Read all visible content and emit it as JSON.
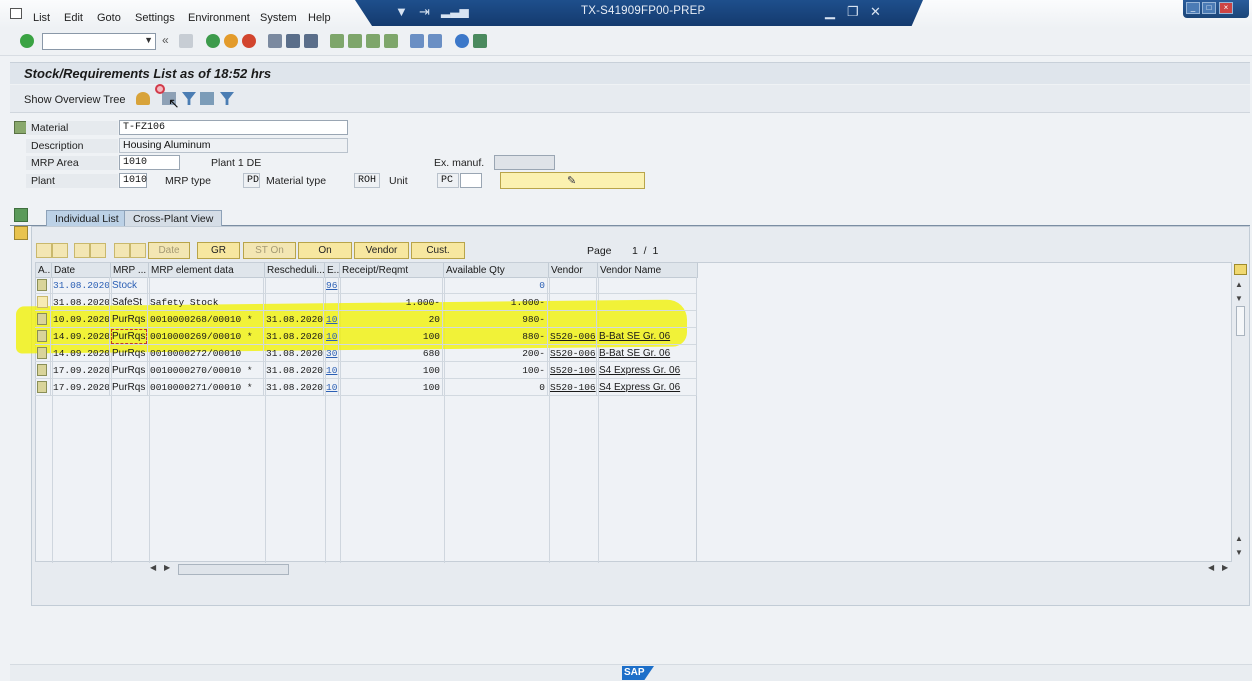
{
  "menu": {
    "items": [
      "List",
      "Edit",
      "Goto",
      "Settings",
      "Environment",
      "System",
      "Help"
    ],
    "underline": [
      "L",
      "E",
      "G",
      "S",
      "n",
      "S",
      "H"
    ]
  },
  "window": {
    "title": "TX-S41909FP00-PREP"
  },
  "page": {
    "title": "Stock/Requirements List as of 18:52 hrs"
  },
  "app_toolbar": {
    "show_tree": "Show Overview Tree"
  },
  "header": {
    "material_label": "Material",
    "material_value": "T-FZ106",
    "description_label": "Description",
    "description_value": "Housing Aluminum",
    "mrp_area_label": "MRP Area",
    "mrp_area_value": "1010",
    "mrp_area_text": "Plant 1 DE",
    "ex_manuf_label": "Ex. manuf.",
    "plant_label": "Plant",
    "plant_value": "1010",
    "mrp_type_label": "MRP type",
    "mrp_type_value": "PD",
    "material_type_label": "Material type",
    "material_type_value": "ROH",
    "unit_label": "Unit",
    "unit_value": "PC"
  },
  "tabs": [
    "Individual List",
    "Cross-Plant View"
  ],
  "grid_toolbar": {
    "date": "Date",
    "gr": "GR",
    "st_on": "ST On",
    "on": "On",
    "vendor": "Vendor",
    "cust": "Cust.",
    "page_label": "Page",
    "page_current": "1",
    "page_total": "1"
  },
  "columns": [
    "A..",
    "Date",
    "MRP ...",
    "MRP element data",
    "Rescheduli...",
    "E..",
    "Receipt/Reqmt",
    "Available Qty",
    "Vendor",
    "Vendor Name"
  ],
  "rows": [
    {
      "date": "31.08.2020",
      "mrp": "Stock",
      "element": "",
      "resched": "",
      "exc": "96",
      "receipt": "",
      "avail": "0",
      "vendor": "",
      "vendor_name": ""
    },
    {
      "date": "31.08.2020",
      "mrp": "SafeSt",
      "element": "Safety Stock",
      "resched": "",
      "exc": "",
      "receipt": "1.000-",
      "avail": "1.000-",
      "vendor": "",
      "vendor_name": ""
    },
    {
      "date": "10.09.2020",
      "mrp": "PurRqs",
      "element": "0010000268/00010 *",
      "resched": "31.08.2020",
      "exc": "10",
      "receipt": "20",
      "avail": "980-",
      "vendor": "",
      "vendor_name": ""
    },
    {
      "date": "14.09.2020",
      "mrp": "PurRqs",
      "element": "0010000269/00010 *",
      "resched": "31.08.2020",
      "exc": "10",
      "receipt": "100",
      "avail": "880-",
      "vendor": "S520-006",
      "vendor_name": "B-Bat SE Gr. 06"
    },
    {
      "date": "14.09.2020",
      "mrp": "PurRqs",
      "element": "0010000272/00010",
      "resched": "31.08.2020",
      "exc": "30",
      "receipt": "680",
      "avail": "200-",
      "vendor": "S520-006",
      "vendor_name": "B-Bat SE Gr. 06"
    },
    {
      "date": "17.09.2020",
      "mrp": "PurRqs",
      "element": "0010000270/00010 *",
      "resched": "31.08.2020",
      "exc": "10",
      "receipt": "100",
      "avail": "100-",
      "vendor": "S520-106",
      "vendor_name": "S4 Express Gr. 06"
    },
    {
      "date": "17.09.2020",
      "mrp": "PurRqs",
      "element": "0010000271/00010 *",
      "resched": "31.08.2020",
      "exc": "10",
      "receipt": "100",
      "avail": "0",
      "vendor": "S520-106",
      "vendor_name": "S4 Express Gr. 06"
    }
  ],
  "footer": {
    "logo": "SAP"
  },
  "colors": {
    "highlight": "#f2f20e",
    "banner": "#1e4f8c",
    "link": "#2b5fb4"
  }
}
